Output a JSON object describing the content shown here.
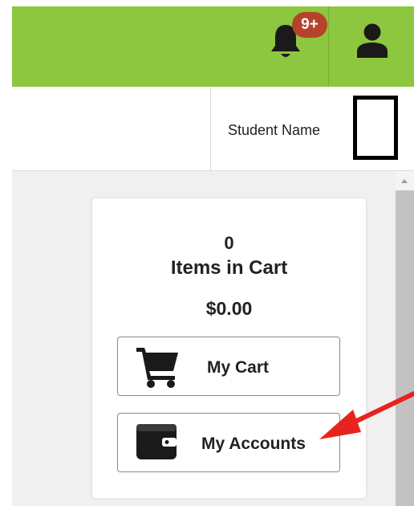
{
  "header": {
    "notification_badge": "9+",
    "icons": {
      "notifications": "bell-icon",
      "user": "user-icon"
    },
    "accent_color": "#8dc63f",
    "badge_color": "#b5422a"
  },
  "user_bar": {
    "student_label": "Student Name"
  },
  "cart": {
    "item_count": "0",
    "items_label": "Items in Cart",
    "total": "$0.00",
    "my_cart_label": "My Cart",
    "my_accounts_label": "My Accounts",
    "icons": {
      "cart": "cart-icon",
      "accounts": "wallet-icon"
    }
  },
  "annotation": {
    "arrow_color": "#e8231f"
  }
}
